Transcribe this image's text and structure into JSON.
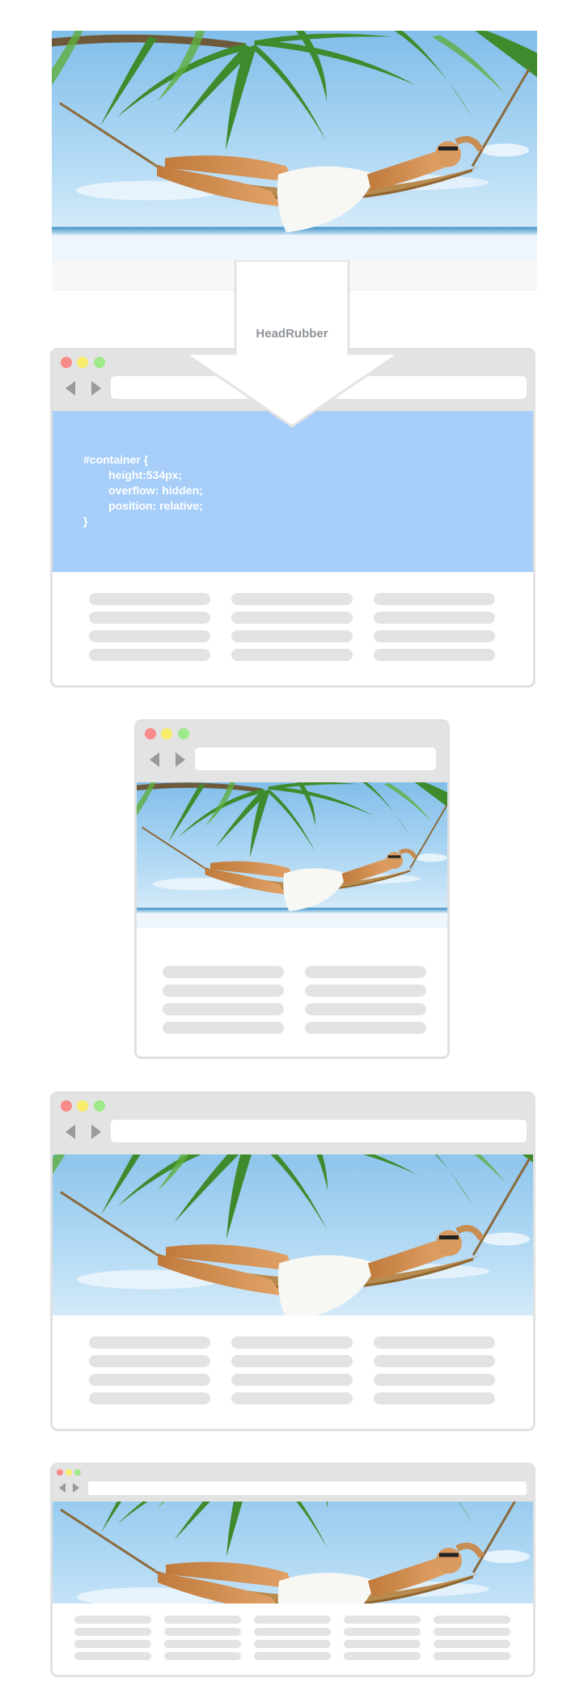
{
  "arrow": {
    "label": "HeadRubber"
  },
  "css_snippet": {
    "lines": [
      "#container {",
      "        height:534px;",
      "        overflow: hidden;",
      "        position: relative;",
      "}"
    ]
  },
  "colors": {
    "sky": "#a9d4f5",
    "code_panel": "#a6cef9",
    "chrome": "#e3e3e3",
    "border": "#e1e1e1",
    "placeholder_line": "#e3e3e3",
    "dot_red": "#f98b8b",
    "dot_yellow": "#f7ed6a",
    "dot_green": "#9ee98a"
  },
  "images": [
    {
      "name": "hero-photo",
      "subject": "woman-in-hammock-under-palm-trees-icon"
    }
  ]
}
